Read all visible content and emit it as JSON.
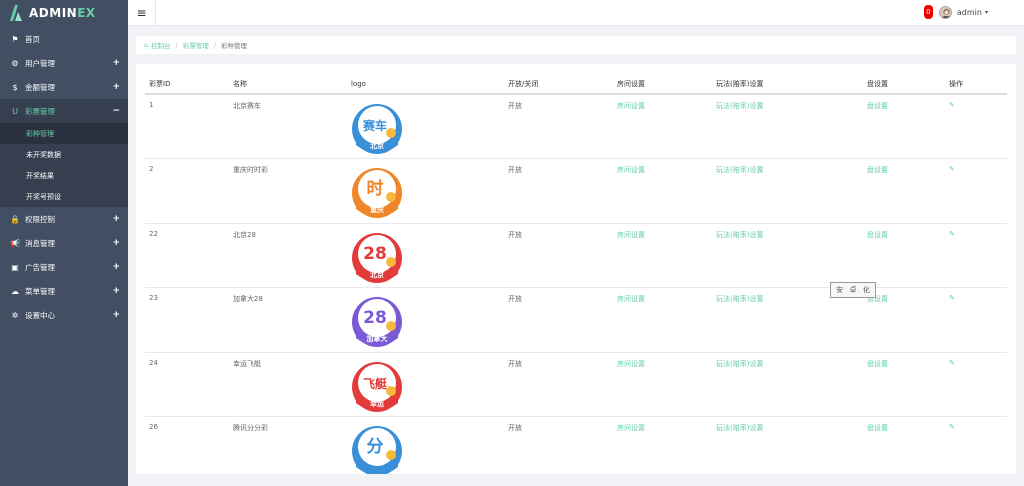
{
  "brand": {
    "text_main": "ADMIN",
    "text_accent": "EX"
  },
  "sidebar": {
    "items": [
      {
        "label": "首页",
        "icon": "flag-icon",
        "glyph": "⚑",
        "expandable": false,
        "active": false
      },
      {
        "label": "用户管理",
        "icon": "gear-icon",
        "glyph": "⚙",
        "expandable": true,
        "active": false
      },
      {
        "label": "金额管理",
        "icon": "dollar-icon",
        "glyph": "$",
        "expandable": true,
        "active": false
      },
      {
        "label": "彩票管理",
        "icon": "magnet-icon",
        "glyph": "Ս",
        "expandable": true,
        "active": true,
        "toggle": "−"
      },
      {
        "label": "权限控制",
        "icon": "lock-icon",
        "glyph": "🔒",
        "expandable": true,
        "active": false
      },
      {
        "label": "消息管理",
        "icon": "bullhorn-icon",
        "glyph": "📢",
        "expandable": true,
        "active": false
      },
      {
        "label": "广告管理",
        "icon": "image-icon",
        "glyph": "▣",
        "expandable": true,
        "active": false
      },
      {
        "label": "菜单管理",
        "icon": "cloud-icon",
        "glyph": "☁",
        "expandable": true,
        "active": false
      },
      {
        "label": "设置中心",
        "icon": "cog-icon",
        "glyph": "✲",
        "expandable": true,
        "active": false
      }
    ],
    "plus": "+",
    "sub_items": [
      {
        "label": "彩种管理",
        "current": true
      },
      {
        "label": "未开奖数据",
        "current": false
      },
      {
        "label": "开奖结果",
        "current": false
      },
      {
        "label": "开奖号预设",
        "current": false
      }
    ]
  },
  "header": {
    "toggle_glyph": "≡",
    "notification_count": "0",
    "user": "admin",
    "caret": "▾"
  },
  "breadcrumb": {
    "home_icon": "⌂",
    "items": [
      "控制台",
      "彩票管理",
      "彩种管理"
    ],
    "sep": "/"
  },
  "table": {
    "columns": [
      "彩票ID",
      "名称",
      "logo",
      "开放/关闭",
      "房间设置",
      "玩法(赔率)设置",
      "盘设置",
      "操作"
    ],
    "rows": [
      {
        "id": "1",
        "name": "北京赛车",
        "logo_text": "赛车",
        "logo_sub": "北京",
        "color": "#3a8fd9",
        "status": "开放",
        "room": "房间设置",
        "play": "玩法(赔率)设置",
        "pan": "盘设置"
      },
      {
        "id": "2",
        "name": "重庆时时彩",
        "logo_text": "时",
        "logo_sub": "重庆",
        "color": "#f0862a",
        "status": "开放",
        "room": "房间设置",
        "play": "玩法(赔率)设置",
        "pan": "盘设置"
      },
      {
        "id": "22",
        "name": "北京28",
        "logo_text": "28",
        "logo_sub": "北京",
        "color": "#e23b3b",
        "status": "开放",
        "room": "房间设置",
        "play": "玩法(赔率)设置",
        "pan": "盘设置"
      },
      {
        "id": "23",
        "name": "加拿大28",
        "logo_text": "28",
        "logo_sub": "加拿大",
        "color": "#7b5ad6",
        "status": "开放",
        "room": "房间设置",
        "play": "玩法(赔率)设置",
        "pan": "盘设置"
      },
      {
        "id": "24",
        "name": "幸运飞艇",
        "logo_text": "飞艇",
        "logo_sub": "幸运",
        "color": "#e23b3b",
        "status": "开放",
        "room": "房间设置",
        "play": "玩法(赔率)设置",
        "pan": "盘设置"
      },
      {
        "id": "26",
        "name": "腾讯分分彩",
        "logo_text": "分",
        "logo_sub": "",
        "color": "#3a8fd9",
        "status": "开放",
        "room": "房间设置",
        "play": "玩法(赔率)设置",
        "pan": "盘设置"
      }
    ],
    "edit_glyph": "✎"
  },
  "watermark": {
    "chars": [
      "安",
      "卓",
      "化"
    ]
  },
  "colors": {
    "accent": "#65cea7",
    "sidebar": "#424f63",
    "sidebar_dark": "#353f4f"
  }
}
